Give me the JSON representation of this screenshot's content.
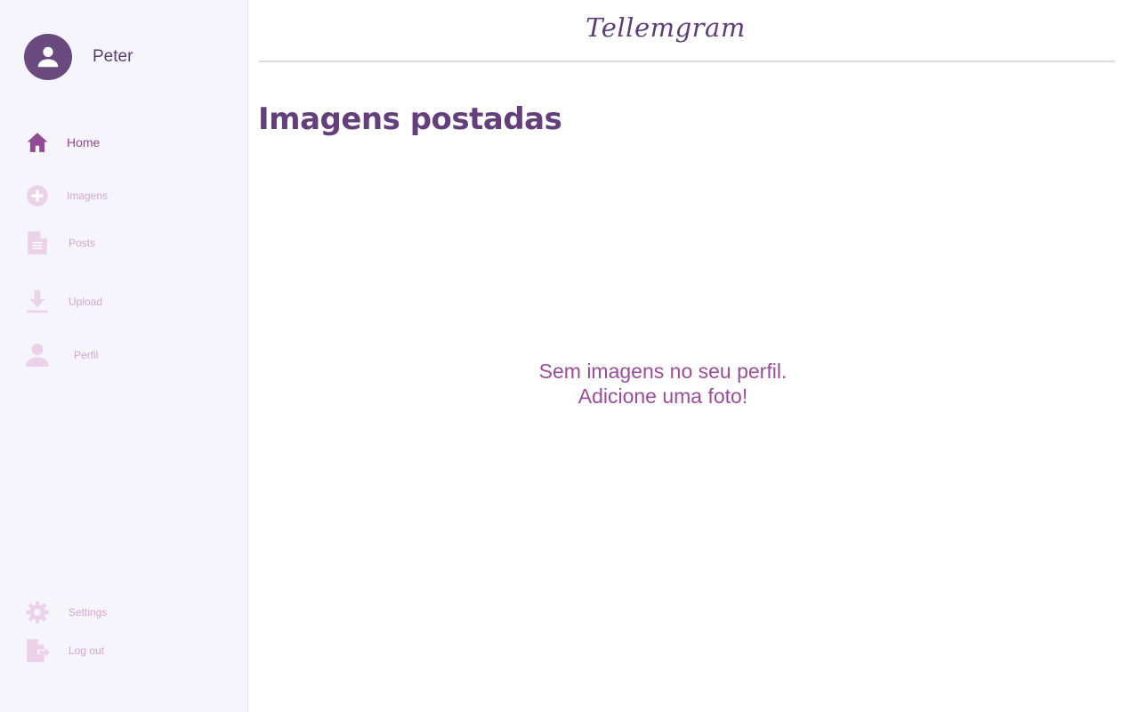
{
  "user": {
    "name": "Peter"
  },
  "sidebar": {
    "items": [
      {
        "label": "Home",
        "icon": "home-icon",
        "active": true
      },
      {
        "label": "Imagens",
        "icon": "add-circle-icon"
      },
      {
        "label": "Posts",
        "icon": "document-icon"
      },
      {
        "label": "Upload",
        "icon": "download-icon"
      },
      {
        "label": "Perfil",
        "icon": "person-icon"
      }
    ],
    "footer": [
      {
        "label": "Settings",
        "icon": "gear-icon"
      },
      {
        "label": "Log out",
        "icon": "logout-icon"
      }
    ]
  },
  "header": {
    "brand": "Tellemgram"
  },
  "main": {
    "title": "Imagens postadas",
    "empty_line1": "Sem imagens no seu perfil.",
    "empty_line2": "Adicione uma foto!"
  },
  "colors": {
    "accent": "#633f7c",
    "active": "#8f4c94",
    "inactive": "#d3a6cf",
    "sidebar_bg": "#f6f5fb"
  }
}
